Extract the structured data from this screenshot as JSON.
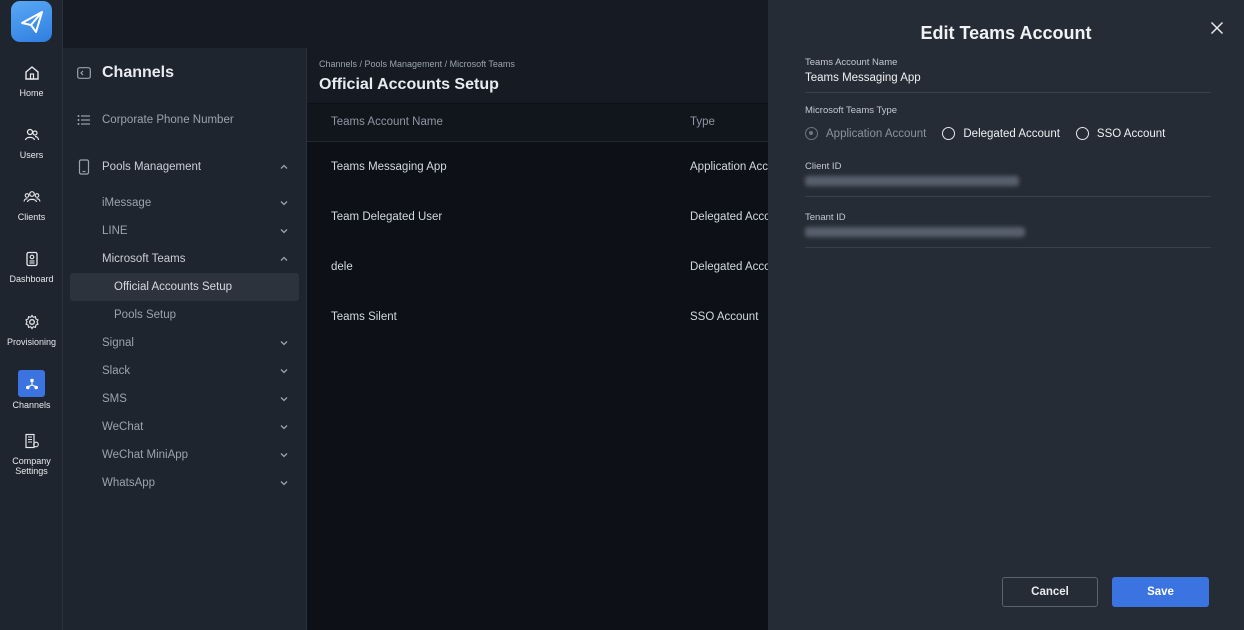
{
  "rail": {
    "items": [
      {
        "label": "Home",
        "icon": "home-icon"
      },
      {
        "label": "Users",
        "icon": "users-icon"
      },
      {
        "label": "Clients",
        "icon": "clients-icon"
      },
      {
        "label": "Dashboard",
        "icon": "dashboard-icon"
      },
      {
        "label": "Provisioning",
        "icon": "gear-icon"
      },
      {
        "label": "Channels",
        "icon": "channels-icon"
      },
      {
        "label_line1": "Company",
        "label_line2": "Settings",
        "icon": "company-settings-icon"
      }
    ]
  },
  "sidebar": {
    "title": "Channels",
    "corporate_phone": "Corporate Phone Number",
    "pools_management": "Pools Management",
    "items": [
      {
        "label": "iMessage"
      },
      {
        "label": "LINE"
      },
      {
        "label": "Microsoft Teams"
      },
      {
        "label": "Official Accounts Setup"
      },
      {
        "label": "Pools Setup"
      },
      {
        "label": "Signal"
      },
      {
        "label": "Slack"
      },
      {
        "label": "SMS"
      },
      {
        "label": "WeChat"
      },
      {
        "label": "WeChat MiniApp"
      },
      {
        "label": "WhatsApp"
      }
    ]
  },
  "main": {
    "breadcrumb": "Channels / Pools Management / Microsoft Teams",
    "title": "Official Accounts Setup",
    "columns": [
      "Teams Account Name",
      "Type"
    ],
    "rows": [
      {
        "name": "Teams Messaging App",
        "type": "Application Account"
      },
      {
        "name": "Team Delegated User",
        "type": "Delegated Account"
      },
      {
        "name": "dele",
        "type": "Delegated Account"
      },
      {
        "name": "Teams Silent",
        "type": "SSO Account"
      }
    ]
  },
  "drawer": {
    "title": "Edit Teams Account",
    "account_name_label": "Teams Account Name",
    "account_name_value": "Teams Messaging App",
    "type_label": "Microsoft Teams Type",
    "type_options": [
      "Application Account",
      "Delegated Account",
      "SSO Account"
    ],
    "selected_type": "Application Account",
    "client_id_label": "Client ID",
    "tenant_id_label": "Tenant ID",
    "cancel_label": "Cancel",
    "save_label": "Save"
  },
  "colors": {
    "accent": "#3b73e0",
    "rail_bg": "#1f252e",
    "drawer_bg": "#262c35",
    "main_bg": "#0d1117"
  }
}
